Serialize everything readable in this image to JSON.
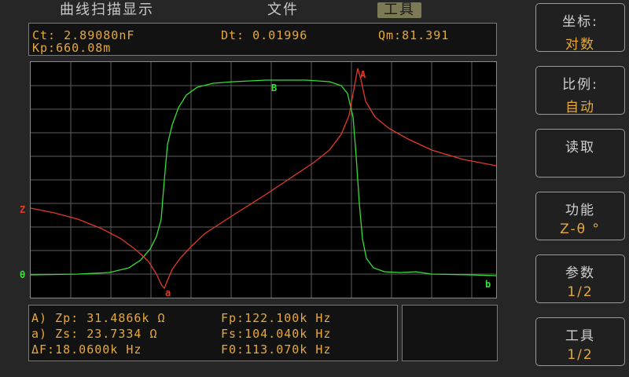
{
  "tabs": [
    {
      "label": "曲线扫描显示"
    },
    {
      "label": "文件"
    },
    {
      "label": "工具"
    }
  ],
  "info": {
    "ct": "Ct: 2.89080nF",
    "dt": "Dt: 0.01996",
    "qm": "Qm:81.391",
    "kp": "Kp:660.08m"
  },
  "plot": {
    "z_label": "Z",
    "theta_label": "θ",
    "marker_A": "A",
    "marker_a": "a",
    "marker_B": "B",
    "marker_b": "b",
    "colors": {
      "z": "#e23a2a",
      "theta": "#35e035",
      "grid": "#6a6a6a"
    }
  },
  "results": {
    "zp": "A) Zp: 31.4866k Ω",
    "zs": "a) Zs: 23.7334  Ω",
    "df": "ΔF:18.0600k Hz",
    "fp": "Fp:122.100k Hz",
    "fs": "Fs:104.040k Hz",
    "f0": "F0:113.070k  Hz"
  },
  "menu": [
    {
      "title": "坐标:",
      "value": "对数"
    },
    {
      "title": "比例:",
      "value": "自动"
    },
    {
      "title": "读取",
      "value": ""
    },
    {
      "title": "功能",
      "value": "Z-θ °"
    },
    {
      "title": "参数",
      "value": "1/2"
    },
    {
      "title": "工具",
      "value": "1/2"
    }
  ]
}
